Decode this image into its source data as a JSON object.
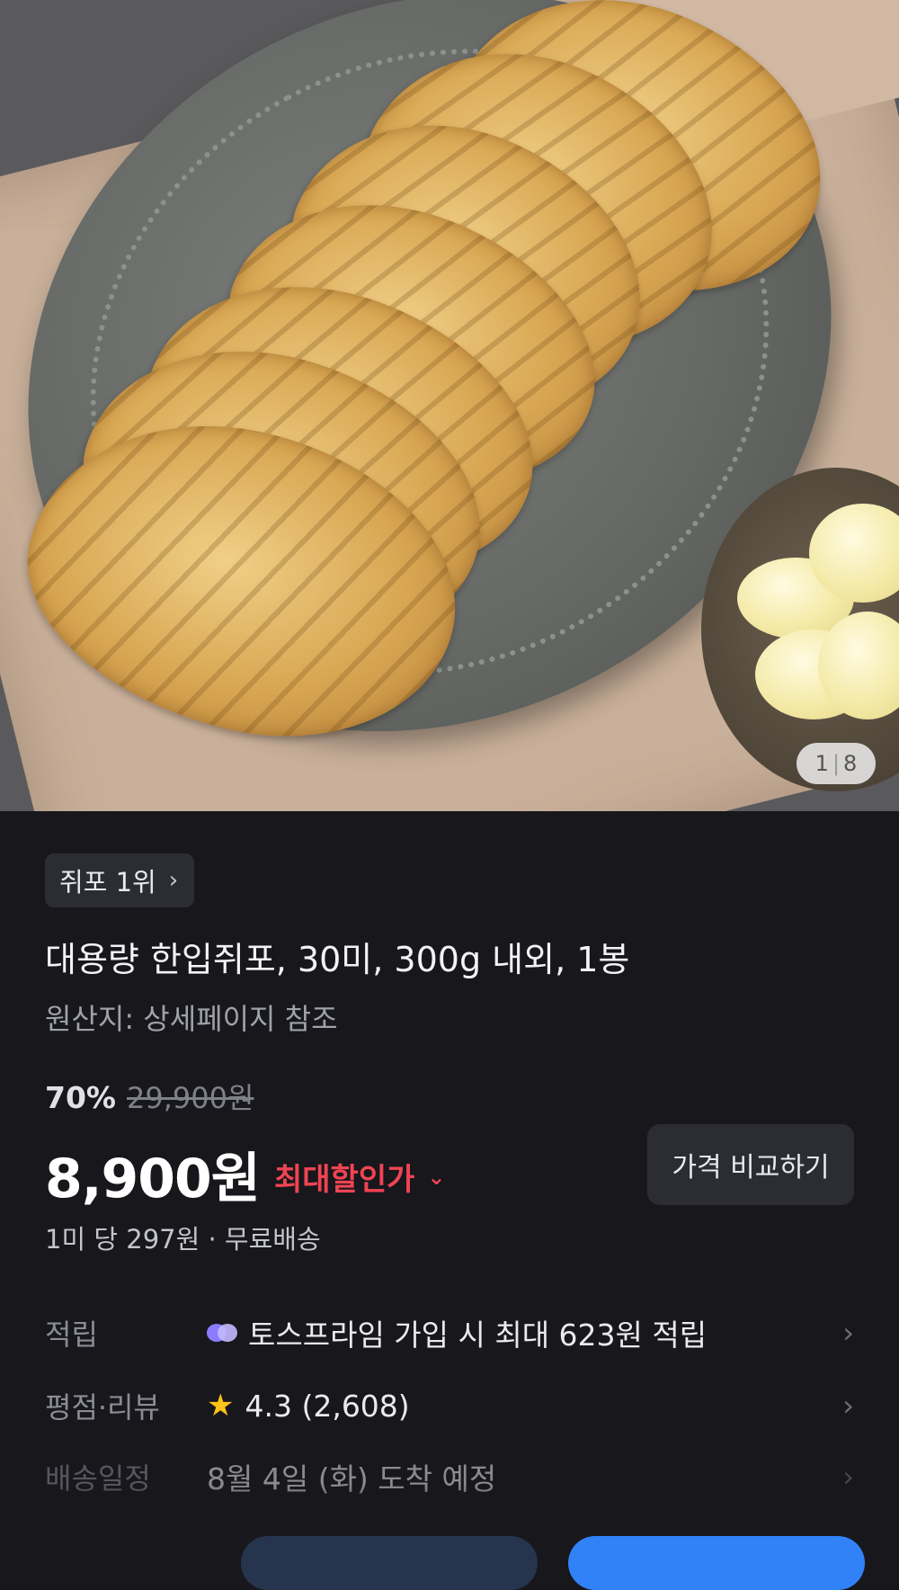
{
  "hero": {
    "image_alt": "product-photo",
    "counter": {
      "current": "1",
      "separator": "|",
      "total": "8"
    }
  },
  "product": {
    "rank_chip": "쥐포 1위",
    "title": "대용량 한입쥐포, 30미, 300g 내외, 1봉",
    "origin": "원산지: 상세페이지 참조",
    "discount_rate": "70%",
    "original_price": "29,900원",
    "price": "8,900원",
    "max_discount_label": "최대할인가",
    "compare_button": "가격 비교하기",
    "unit_info": "1미 당 297원 · 무료배송"
  },
  "info_rows": {
    "points": {
      "label": "적립",
      "value": "토스프라임 가입 시 최대 623원 적립"
    },
    "rating": {
      "label": "평점·리뷰",
      "value": "4.3 (2,608)"
    },
    "delivery": {
      "label": "배송일정",
      "value": "8월 4일 (화) 도착 예정"
    }
  },
  "colors": {
    "background": "#17171c",
    "accent_red": "#f04452",
    "accent_blue": "#3182f6",
    "star": "#ffc21a"
  },
  "icons": {
    "chip_chevron": "chevron-right-icon",
    "discount_chevron": "chevron-down-icon",
    "row_arrow": "chevron-right-icon",
    "prime": "toss-prime-icon",
    "star": "star-icon"
  }
}
